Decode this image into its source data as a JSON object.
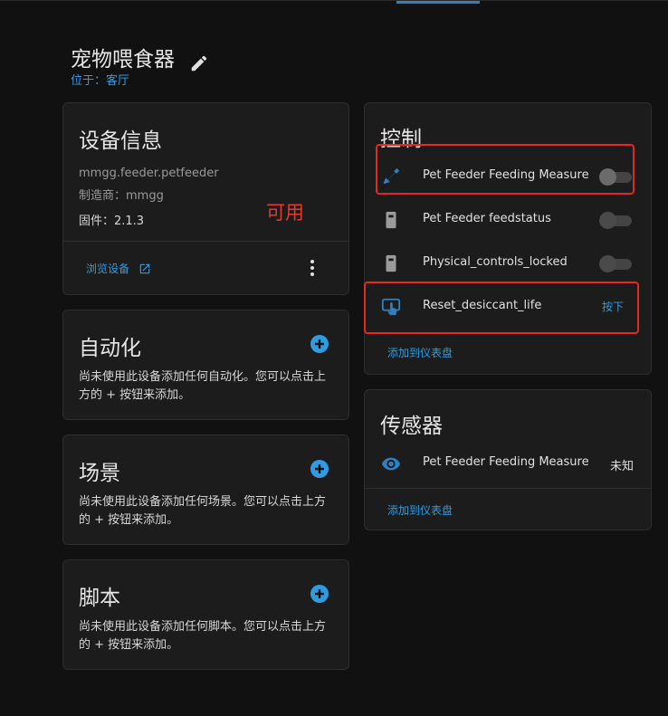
{
  "device": {
    "title": "宠物喂食器",
    "location": "位于：客厅"
  },
  "info": {
    "title": "设备信息",
    "model": "mmgg.feeder.petfeeder",
    "manufacturer": "制造商：mmgg",
    "firmware": "固件：2.1.3",
    "annotation": "可用",
    "browse_label": "浏览设备"
  },
  "automation": {
    "title": "自动化",
    "description": "尚未使用此设备添加任何自动化。您可以点击上方的 + 按钮来添加。"
  },
  "scene": {
    "title": "场景",
    "description": "尚未使用此设备添加任何场景。您可以点击上方的 + 按钮来添加。"
  },
  "script": {
    "title": "脚本",
    "description": "尚未使用此设备添加任何脚本。您可以点击上方的 + 按钮来添加。"
  },
  "controls": {
    "title": "控制",
    "items": [
      {
        "label": "Pet Feeder Feeding Measure",
        "icon": "pet-food-icon",
        "type": "toggle",
        "state": "off"
      },
      {
        "label": "Pet Feeder feedstatus",
        "icon": "switch-icon",
        "type": "toggle",
        "state": "off"
      },
      {
        "label": "Physical_controls_locked",
        "icon": "switch-icon",
        "type": "toggle",
        "state": "off"
      },
      {
        "label": "Reset_desiccant_life",
        "icon": "gesture-tap-button-icon",
        "type": "button",
        "action": "按下"
      }
    ],
    "add_to_dashboard": "添加到仪表盘"
  },
  "sensors": {
    "title": "传感器",
    "items": [
      {
        "label": "Pet Feeder Feeding Measure",
        "icon": "eye-icon",
        "value": "未知"
      }
    ],
    "add_to_dashboard": "添加到仪表盘"
  },
  "colors": {
    "accent": "#2f9be0",
    "annotation": "#e02a1f",
    "background": "#111111",
    "card": "#1c1c1c"
  }
}
